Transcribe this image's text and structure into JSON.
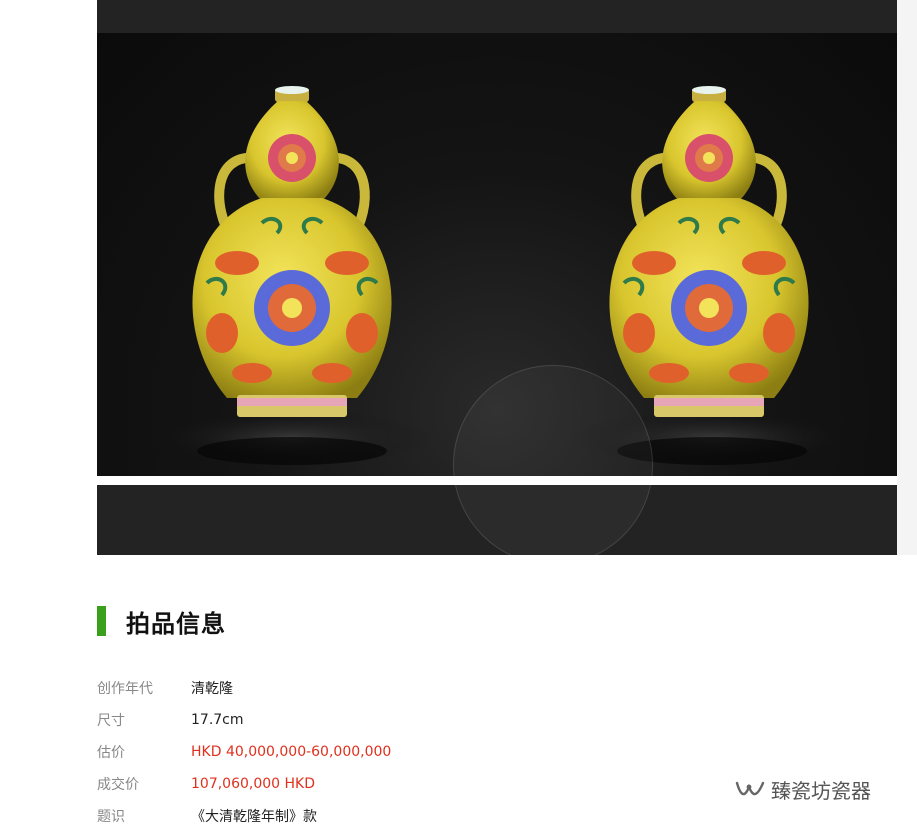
{
  "gallery": {
    "image_alt": "清乾隆黄地粉彩葫芦瓶"
  },
  "section": {
    "title": "拍品信息"
  },
  "info": [
    {
      "label": "创作年代",
      "value": "清乾隆",
      "highlight": false
    },
    {
      "label": "尺寸",
      "value": "17.7cm",
      "highlight": false
    },
    {
      "label": "估价",
      "value": "HKD 40,000,000-60,000,000",
      "highlight": true
    },
    {
      "label": "成交价",
      "value": "107,060,000 HKD",
      "highlight": true
    },
    {
      "label": "题识",
      "value": "《大清乾隆年制》款",
      "highlight": false
    }
  ],
  "watermark": {
    "text": "臻瓷坊瓷器",
    "icon": "wechat-channel-icon"
  },
  "colors": {
    "accent_green": "#3aa01c",
    "price_red": "#e0301e",
    "gallery_bg": "#232323"
  }
}
